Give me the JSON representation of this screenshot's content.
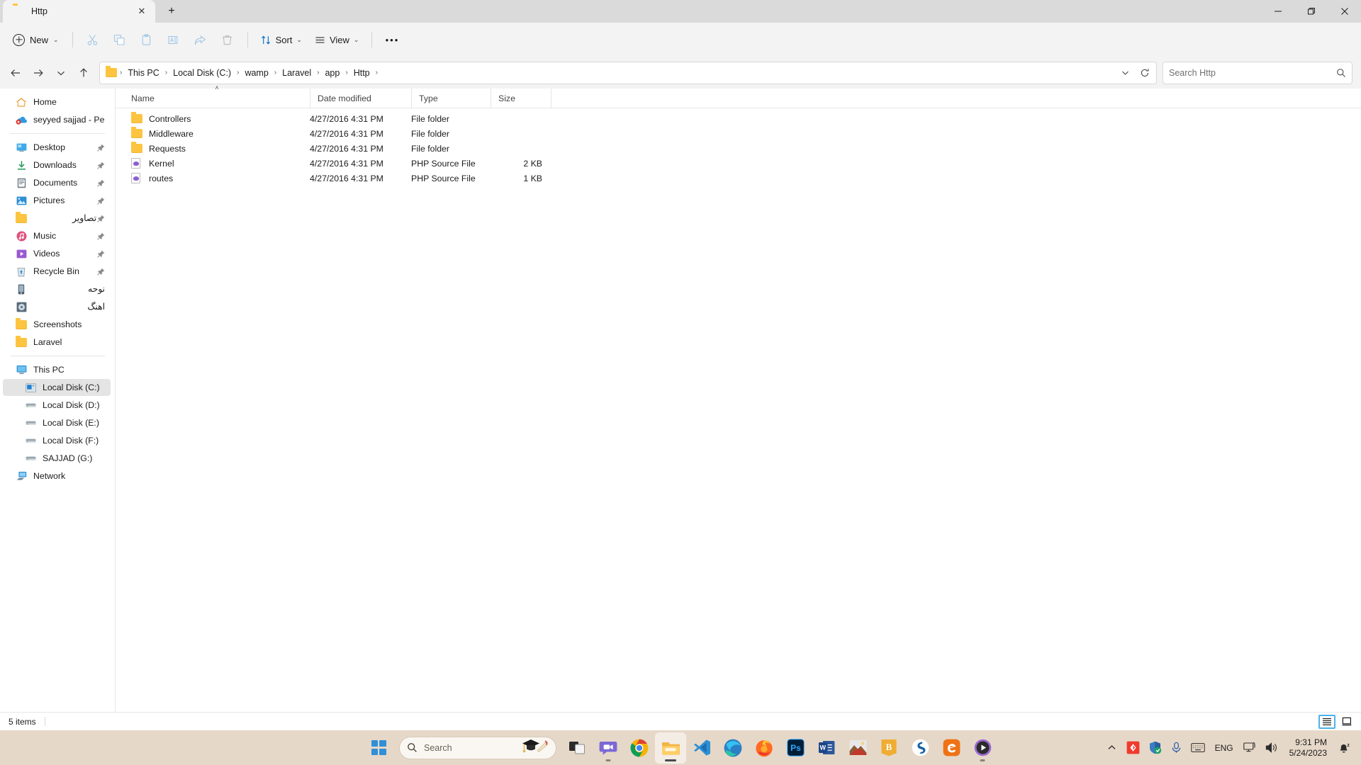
{
  "window": {
    "tab_title": "Http",
    "tab_icon": "folder-icon",
    "new_tab_label": "+",
    "minimize_label": "—",
    "maximize_label": "❐",
    "close_label": "✕"
  },
  "toolbar": {
    "new_label": "New",
    "new_chevron": "⌄",
    "cut_label": "Cut",
    "copy_label": "Copy",
    "paste_label": "Paste",
    "rename_label": "Rename",
    "share_label": "Share",
    "delete_label": "Delete",
    "sort_label": "Sort",
    "view_label": "View",
    "more_label": "•••"
  },
  "nav": {
    "back_label": "←",
    "forward_label": "→",
    "recent_label": "⌄",
    "up_label": "↑",
    "refresh_label": "↻",
    "previous_locations_label": "⌄",
    "breadcrumbs": [
      {
        "label": "This PC"
      },
      {
        "label": "Local Disk (C:)"
      },
      {
        "label": "wamp"
      },
      {
        "label": "Laravel"
      },
      {
        "label": "app"
      },
      {
        "label": "Http"
      }
    ],
    "separator": "›"
  },
  "search": {
    "placeholder": "Search Http",
    "value": "",
    "icon": "search-icon"
  },
  "sidebar": {
    "groups": [
      {
        "items": [
          {
            "label": "Home",
            "icon": "home-icon",
            "pinned": false,
            "selected": false,
            "rtl": false,
            "indent": 0
          },
          {
            "label": "seyyed sajjad - Perso",
            "icon": "onedrive-error-icon",
            "pinned": false,
            "selected": false,
            "rtl": false,
            "indent": 0
          }
        ]
      },
      {
        "items": [
          {
            "label": "Desktop",
            "icon": "desktop-icon",
            "pinned": true,
            "selected": false,
            "rtl": false,
            "indent": 0
          },
          {
            "label": "Downloads",
            "icon": "downloads-icon",
            "pinned": true,
            "selected": false,
            "rtl": false,
            "indent": 0
          },
          {
            "label": "Documents",
            "icon": "documents-icon",
            "pinned": true,
            "selected": false,
            "rtl": false,
            "indent": 0
          },
          {
            "label": "Pictures",
            "icon": "pictures-icon",
            "pinned": true,
            "selected": false,
            "rtl": false,
            "indent": 0
          },
          {
            "label": "تصاویر",
            "icon": "folder-icon",
            "pinned": true,
            "selected": false,
            "rtl": true,
            "indent": 0
          },
          {
            "label": "Music",
            "icon": "music-icon",
            "pinned": true,
            "selected": false,
            "rtl": false,
            "indent": 0
          },
          {
            "label": "Videos",
            "icon": "videos-icon",
            "pinned": true,
            "selected": false,
            "rtl": false,
            "indent": 0
          },
          {
            "label": "Recycle Bin",
            "icon": "recycle-bin-icon",
            "pinned": true,
            "selected": false,
            "rtl": false,
            "indent": 0
          },
          {
            "label": "نوحه",
            "icon": "phone-icon",
            "pinned": false,
            "selected": false,
            "rtl": true,
            "indent": 0
          },
          {
            "label": "اهنگ",
            "icon": "disc-icon",
            "pinned": false,
            "selected": false,
            "rtl": true,
            "indent": 0
          },
          {
            "label": "Screenshots",
            "icon": "folder-icon",
            "pinned": false,
            "selected": false,
            "rtl": false,
            "indent": 0
          },
          {
            "label": "Laravel",
            "icon": "folder-icon",
            "pinned": false,
            "selected": false,
            "rtl": false,
            "indent": 0
          }
        ]
      },
      {
        "items": [
          {
            "label": "This PC",
            "icon": "this-pc-icon",
            "pinned": false,
            "selected": false,
            "rtl": false,
            "indent": 0
          },
          {
            "label": "Local Disk (C:)",
            "icon": "windows-drive-icon",
            "pinned": false,
            "selected": true,
            "rtl": false,
            "indent": 1
          },
          {
            "label": "Local Disk (D:)",
            "icon": "drive-icon",
            "pinned": false,
            "selected": false,
            "rtl": false,
            "indent": 1
          },
          {
            "label": "Local Disk (E:)",
            "icon": "drive-icon",
            "pinned": false,
            "selected": false,
            "rtl": false,
            "indent": 1
          },
          {
            "label": "Local Disk (F:)",
            "icon": "drive-icon",
            "pinned": false,
            "selected": false,
            "rtl": false,
            "indent": 1
          },
          {
            "label": "SAJJAD (G:)",
            "icon": "drive-icon",
            "pinned": false,
            "selected": false,
            "rtl": false,
            "indent": 1
          },
          {
            "label": "Network",
            "icon": "network-icon",
            "pinned": false,
            "selected": false,
            "rtl": false,
            "indent": 0
          }
        ]
      }
    ],
    "pin_glyph": "📌"
  },
  "filelist": {
    "columns": [
      {
        "label": "Name",
        "sorted": "asc"
      },
      {
        "label": "Date modified",
        "sorted": ""
      },
      {
        "label": "Type",
        "sorted": ""
      },
      {
        "label": "Size",
        "sorted": ""
      }
    ],
    "sort_arrow": "˄",
    "rows": [
      {
        "name": "Controllers",
        "date": "4/27/2016 4:31 PM",
        "type": "File folder",
        "size": "",
        "icon": "folder-icon"
      },
      {
        "name": "Middleware",
        "date": "4/27/2016 4:31 PM",
        "type": "File folder",
        "size": "",
        "icon": "folder-icon"
      },
      {
        "name": "Requests",
        "date": "4/27/2016 4:31 PM",
        "type": "File folder",
        "size": "",
        "icon": "folder-icon"
      },
      {
        "name": "Kernel",
        "date": "4/27/2016 4:31 PM",
        "type": "PHP Source File",
        "size": "2 KB",
        "icon": "php-file-icon"
      },
      {
        "name": "routes",
        "date": "4/27/2016 4:31 PM",
        "type": "PHP Source File",
        "size": "1 KB",
        "icon": "php-file-icon"
      }
    ]
  },
  "statusbar": {
    "item_count": "5 items",
    "details_view_label": "Details view",
    "large_icons_view_label": "Large icons view"
  },
  "taskbar": {
    "start_label": "Start",
    "search_placeholder": "Search",
    "search_icon": "search-icon",
    "items": [
      {
        "name": "task-view",
        "label": "Task View",
        "active": false,
        "running": false
      },
      {
        "name": "chat",
        "label": "Chat",
        "active": false,
        "running": true
      },
      {
        "name": "google-chrome",
        "label": "Google Chrome",
        "active": false,
        "running": false
      },
      {
        "name": "file-explorer",
        "label": "File Explorer",
        "active": true,
        "running": true
      },
      {
        "name": "visual-studio-code",
        "label": "Visual Studio Code",
        "active": false,
        "running": false
      },
      {
        "name": "microsoft-edge",
        "label": "Microsoft Edge",
        "active": false,
        "running": false
      },
      {
        "name": "firefox",
        "label": "Mozilla Firefox",
        "active": false,
        "running": false
      },
      {
        "name": "photoshop",
        "label": "Adobe Photoshop",
        "active": false,
        "running": false
      },
      {
        "name": "word",
        "label": "Microsoft Word",
        "active": false,
        "running": false
      },
      {
        "name": "photo",
        "label": "Photos",
        "active": false,
        "running": false
      },
      {
        "name": "bootstrap",
        "label": "Bootstrap Studio",
        "active": false,
        "running": false
      },
      {
        "name": "soundtrack",
        "label": "Soundtrack",
        "active": false,
        "running": false
      },
      {
        "name": "eviews",
        "label": "EViews",
        "active": false,
        "running": false
      },
      {
        "name": "media-player",
        "label": "Media Player",
        "active": false,
        "running": true
      }
    ],
    "tray": {
      "show_hidden_label": "∧",
      "icons": [
        {
          "name": "internet-download-manager-icon",
          "label": "IDM"
        },
        {
          "name": "windows-security-icon",
          "label": "Windows Security"
        },
        {
          "name": "microphone-icon",
          "label": "Microphone"
        },
        {
          "name": "touch-keyboard-icon",
          "label": "Touch keyboard"
        }
      ],
      "language": "ENG",
      "network_label": "Network",
      "volume_label": "Volume",
      "time": "9:31 PM",
      "date": "5/24/2023",
      "notification_label": "Notifications"
    }
  },
  "colors": {
    "accent": "#0078d4",
    "folder": "#fdc43f",
    "taskbar": "#e6d8c8",
    "selected_row": "#e4e4e4"
  }
}
